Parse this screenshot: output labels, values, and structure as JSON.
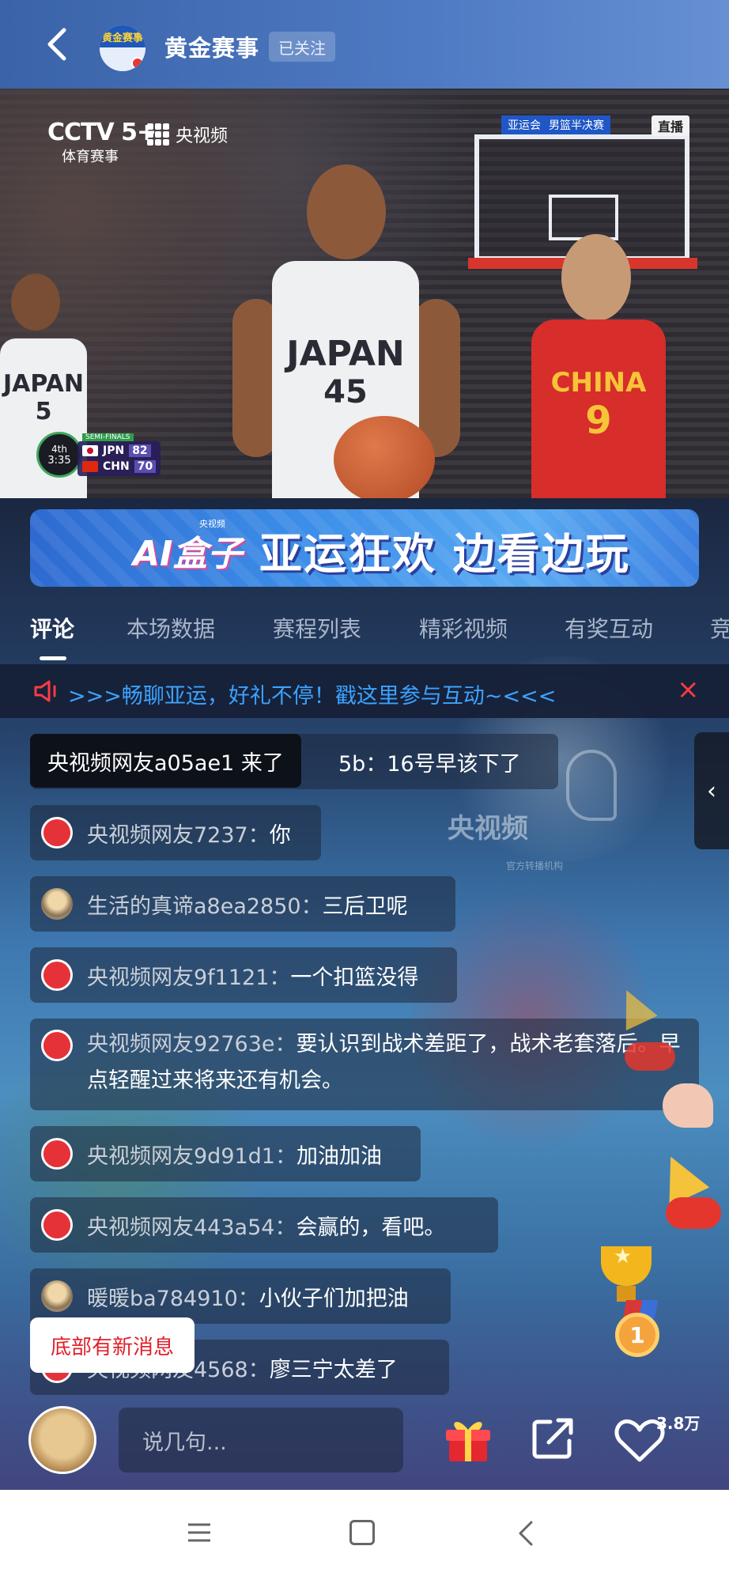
{
  "header": {
    "back_icon": "chevron-left-icon",
    "channel_logo_text": "黄金赛事",
    "channel_name": "黄金赛事",
    "follow_status": "已关注"
  },
  "video": {
    "broadcaster": "CCTV 5+",
    "broadcaster_sub": "体育赛事",
    "platform": "央视频",
    "event_tag": "亚运会",
    "event_stage": "男篮半决赛",
    "live_label": "直播",
    "scoreboard": {
      "period": "4th",
      "clock": "3:35",
      "stage_label": "SEMI-FINALS",
      "teams": [
        {
          "code": "JPN",
          "score": "82"
        },
        {
          "code": "CHN",
          "score": "70"
        }
      ]
    },
    "jerseys": [
      {
        "text": "JAPAN",
        "number": "5"
      },
      {
        "text": "JAPAN",
        "number": "45"
      },
      {
        "text": "CHINA",
        "number": "9"
      }
    ]
  },
  "banner": {
    "ai_text": "AI盒子",
    "ai_sub": "央视频",
    "title": "亚运狂欢 边看边玩"
  },
  "tabs": [
    {
      "label": "评论",
      "active": true
    },
    {
      "label": "本场数据",
      "active": false
    },
    {
      "label": "赛程列表",
      "active": false
    },
    {
      "label": "精彩视频",
      "active": false
    },
    {
      "label": "有奖互动",
      "active": false
    },
    {
      "label": "竞",
      "active": false
    }
  ],
  "notice": {
    "icon": "megaphone-icon",
    "text": ">>>畅聊亚运，好礼不停！戳这里参与互动~<<<",
    "close": "×"
  },
  "join_toast": "央视频网友a05ae1 来了",
  "comments": [
    {
      "user": "",
      "sep": "",
      "text": "5b：16号早该下了",
      "avatar": "hidden"
    },
    {
      "user": "央视频网友7237",
      "sep": "：",
      "text": "你",
      "avatar": "default-red"
    },
    {
      "user": "生活的真谛a8ea2850",
      "sep": "：",
      "text": "三后卫呢",
      "avatar": "photo"
    },
    {
      "user": "央视频网友9f1121",
      "sep": "：",
      "text": "一个扣篮没得",
      "avatar": "default-red"
    },
    {
      "user": "央视频网友92763e",
      "sep": "：",
      "text": "要认识到战术差距了，战术老套落后。早点轻醒过来将来还有机会。",
      "avatar": "default-red"
    },
    {
      "user": "央视频网友9d91d1",
      "sep": "：",
      "text": "加油加油",
      "avatar": "default-red"
    },
    {
      "user": "央视频网友443a54",
      "sep": "：",
      "text": "会赢的，看吧。",
      "avatar": "default-red"
    },
    {
      "user": "暖暖ba784910",
      "sep": "：",
      "text": "小伙子们加把油",
      "avatar": "photo"
    },
    {
      "user": "央视频网友4568",
      "sep": "：",
      "text": "廖三宁太差了",
      "avatar": "default-red"
    }
  ],
  "watermark": {
    "text": "央视频",
    "sub": "官方转播机构"
  },
  "side_toggle": "‹",
  "new_message_button": "底部有新消息",
  "bottom_bar": {
    "input_placeholder": "说几句...",
    "gift_icon": "gift-icon",
    "share_icon": "share-icon",
    "like_icon": "heart-icon",
    "like_count": "3.8万"
  },
  "colors": {
    "header": "#4a73bb",
    "accent_blue": "#3ba3ff",
    "accent_red": "#e0202b",
    "jersey_china": "#d72d2b"
  }
}
